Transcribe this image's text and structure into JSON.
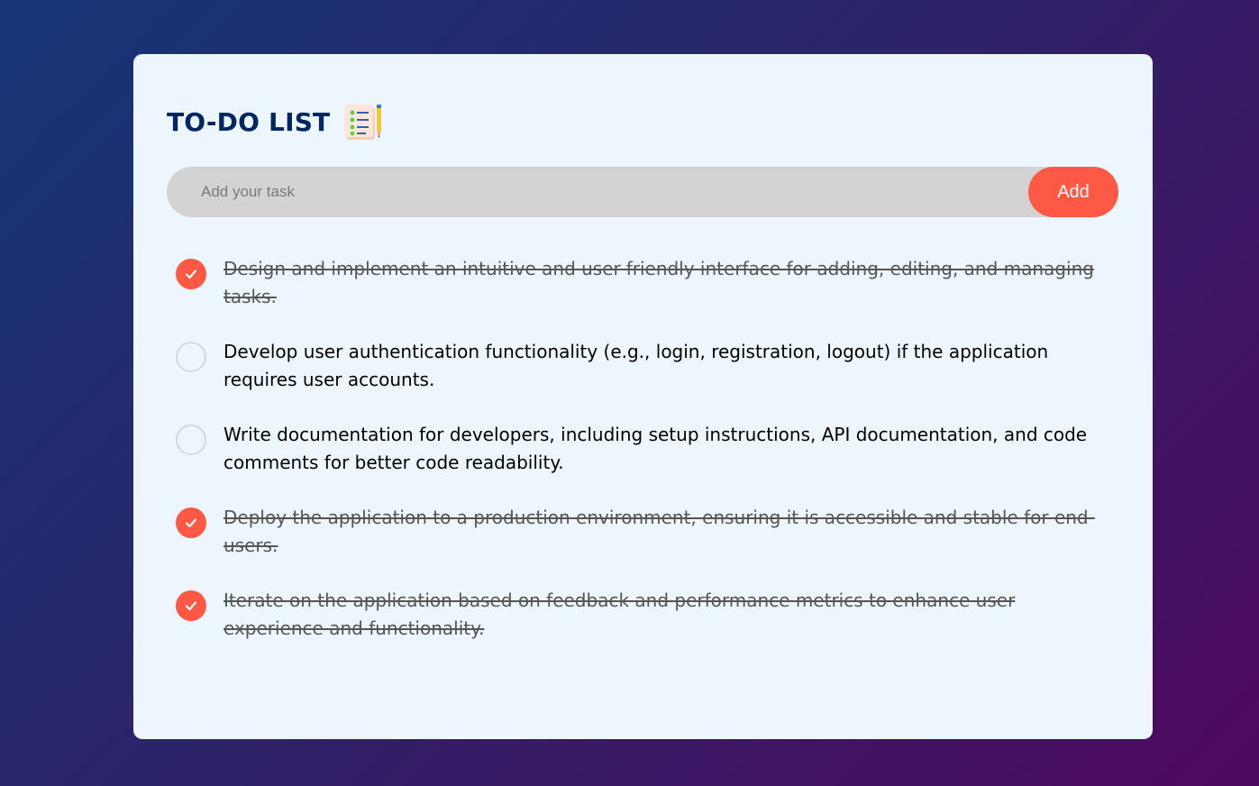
{
  "app": {
    "title": "TO-DO LIST",
    "title_icon": "notepad-checklist-icon"
  },
  "input": {
    "placeholder": "Add your task",
    "value": "",
    "add_label": "Add"
  },
  "colors": {
    "accent": "#ff5945",
    "title": "#002765",
    "card_bg": "#edf5fd",
    "input_bg": "#d3d3d3"
  },
  "tasks": [
    {
      "text": "Design and implement an intuitive and user-friendly interface for adding, editing, and managing tasks.",
      "done": true
    },
    {
      "text": "Develop user authentication functionality (e.g., login, registration, logout) if the application requires user accounts.",
      "done": false
    },
    {
      "text": "Write documentation for developers, including setup instructions, API documentation, and code comments for better code readability.",
      "done": false
    },
    {
      "text": "Deploy the application to a production environment, ensuring it is accessible and stable for end-users.",
      "done": true
    },
    {
      "text": "Iterate on the application based on feedback and performance metrics to enhance user experience and functionality.",
      "done": true
    }
  ]
}
